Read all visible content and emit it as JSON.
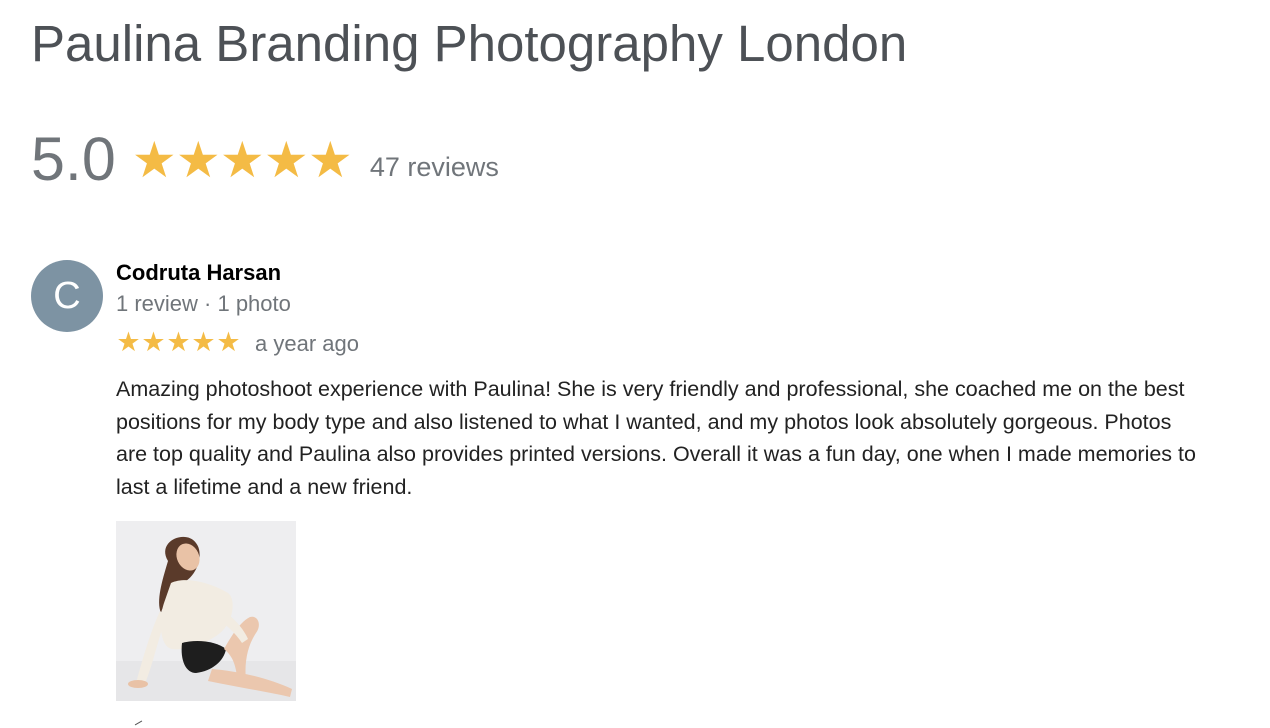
{
  "business": {
    "title": "Paulina Branding Photography London"
  },
  "rating": {
    "score": "5.0",
    "stars": 5,
    "review_count": "47 reviews",
    "star_color": "#f4bb45"
  },
  "review": {
    "avatar_letter": "C",
    "avatar_color": "#7d93a3",
    "name": "Codruta Harsan",
    "meta": "1 review · 1 photo",
    "stars": 5,
    "date": "a year ago",
    "text": "Amazing photoshoot experience with Paulina! She is very friendly and professional, she coached me on the best positions for my body type and also listened to what I wanted, and my photos look absolutely gorgeous. Photos are top quality and Paulina also provides printed versions. Overall it was a fun day, one when I made memories to last a lifetime and a new friend.",
    "photo_icon": "review-photo-thumbnail"
  },
  "icons": {
    "star": "★"
  }
}
